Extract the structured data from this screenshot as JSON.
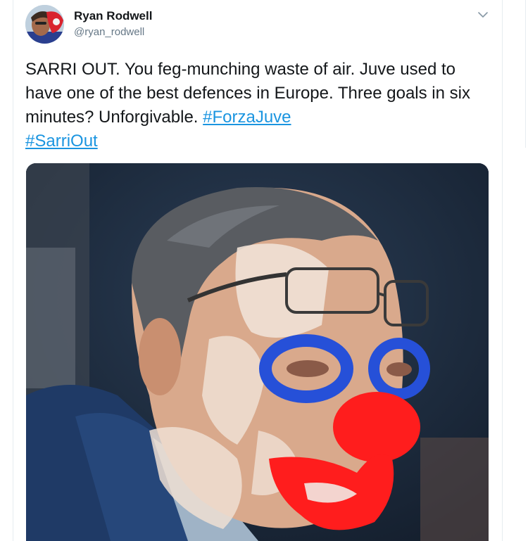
{
  "tweet": {
    "author_name": "Ryan Rodwell",
    "author_handle": "@ryan_rodwell",
    "text": "SARRI OUT. You feg-munching waste of air. Juve used to have one of the best defences in Europe. Three goals in six minutes? Unforgivable.",
    "hashtags": [
      "#ForzaJuve",
      "#SarriOut"
    ],
    "menu_icon": "chevron-down-icon",
    "media_description": "photo of a man wearing glasses with clown face paint drawn over it"
  },
  "colors": {
    "link": "#1b95e0",
    "text": "#14171a",
    "secondary": "#657786",
    "border": "#e6ecf0"
  }
}
